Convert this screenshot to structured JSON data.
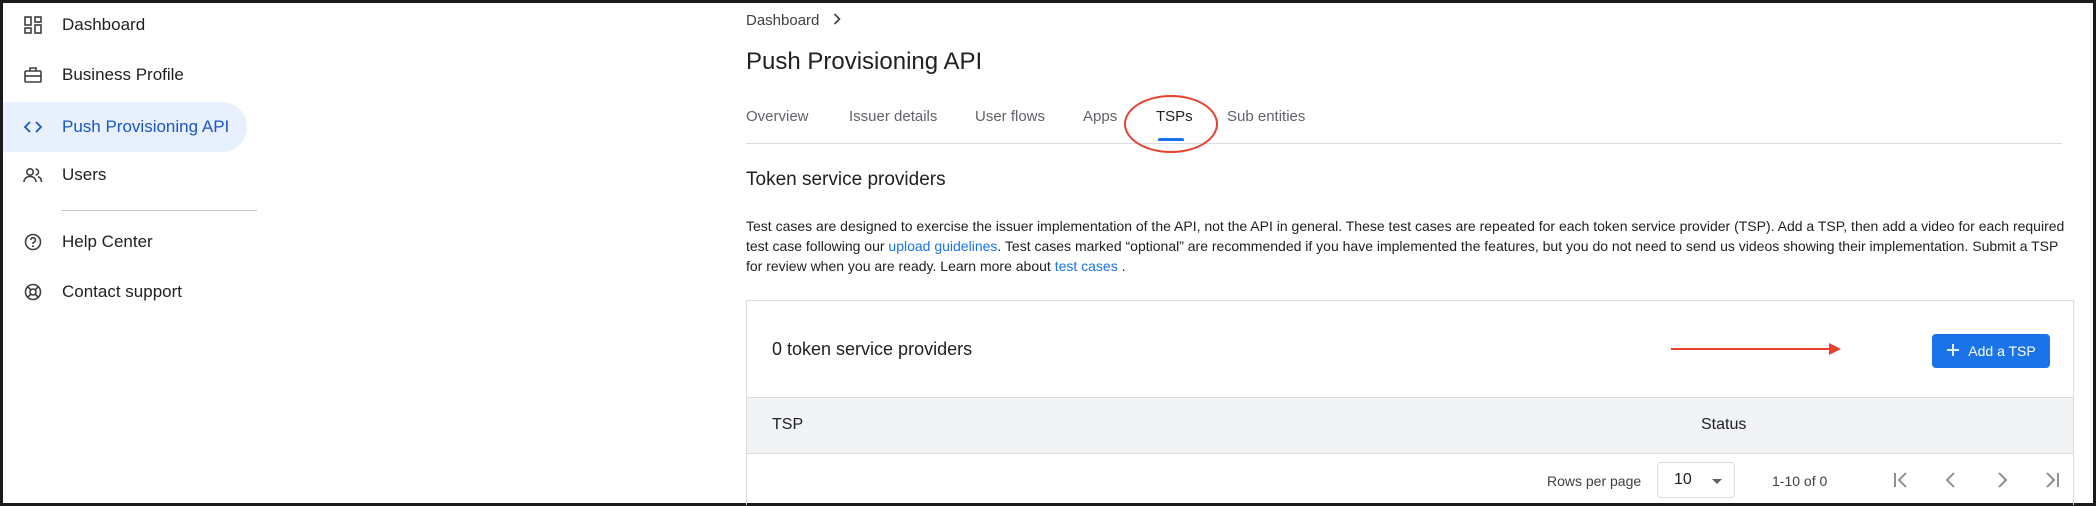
{
  "sidebar": {
    "items": [
      {
        "label": "Dashboard",
        "icon": "dashboard-icon"
      },
      {
        "label": "Business Profile",
        "icon": "briefcase-icon"
      },
      {
        "label": "Push Provisioning API",
        "icon": "code-icon",
        "active": true
      },
      {
        "label": "Users",
        "icon": "users-icon"
      }
    ],
    "secondary": [
      {
        "label": "Help Center",
        "icon": "help-icon"
      },
      {
        "label": "Contact support",
        "icon": "support-icon"
      }
    ]
  },
  "breadcrumb": {
    "item": "Dashboard",
    "separator_icon": "chevron-right-icon"
  },
  "page": {
    "title": "Push Provisioning API"
  },
  "tabs": [
    {
      "label": "Overview"
    },
    {
      "label": "Issuer details"
    },
    {
      "label": "User flows"
    },
    {
      "label": "Apps"
    },
    {
      "label": "TSPs",
      "active": true
    },
    {
      "label": "Sub entities"
    }
  ],
  "section": {
    "title": "Token service providers",
    "description_1": "Test cases are designed to exercise the issuer implementation of the API, not the API in general. These test cases are repeated for each token service provider (TSP). Add a TSP, then add a video for each required test case following our ",
    "link_1": "upload guidelines",
    "description_2": ". Test cases marked “optional” are recommended if you have implemented the features, but you do not need to send us videos showing their implementation. Submit a TSP for review when you are ready. Learn more about ",
    "link_2": "test cases",
    "description_3": " ."
  },
  "card": {
    "count_label": "0 token service providers",
    "add_button": "Add a TSP",
    "columns": [
      "TSP",
      "Status"
    ],
    "pager": {
      "rows_label": "Rows per page",
      "rows_value": "10",
      "range": "1-10 of 0"
    }
  },
  "colors": {
    "accent": "#1a73e8",
    "active_nav_bg": "#e8f0fe",
    "annotation": "#e8402c"
  }
}
